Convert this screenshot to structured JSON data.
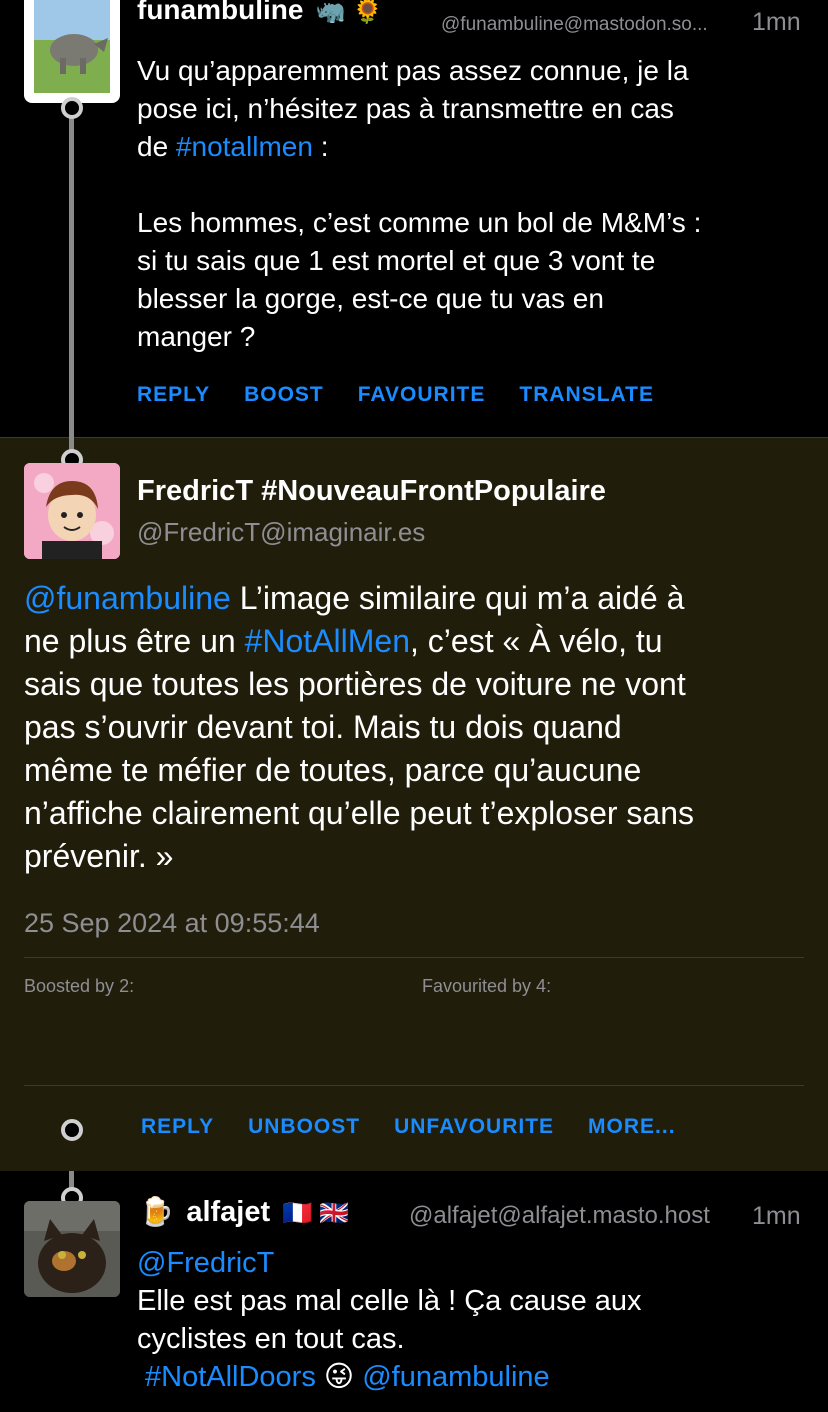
{
  "post1": {
    "display_name": "funambuline",
    "emojis": "🦏 🌻",
    "handle": "@funambuline@mastodon.so...",
    "time": "1mn",
    "text_line1": "Vu qu’apparemment pas assez connue, je la",
    "text_line2": "pose ici, n’hésitez pas à transmettre en cas",
    "text_line3_prefix": "de ",
    "hashtag": "#notallmen",
    "text_line3_suffix": " :",
    "para2_line1": "Les hommes, c’est comme un bol de M&M’s :",
    "para2_line2": "si tu sais que 1 est mortel et que 3 vont te",
    "para2_line3": "blesser la gorge, est-ce que tu vas en",
    "para2_line4": "manger ?",
    "actions": {
      "reply": "REPLY",
      "boost": "BOOST",
      "favourite": "FAVOURITE",
      "translate": "TRANSLATE"
    }
  },
  "post2": {
    "display_name": "FredricT #NouveauFrontPopulaire",
    "handle": "@FredricT@imaginair.es",
    "mention": "@funambuline",
    "line1_rest": " L’image similaire qui m’a aidé à",
    "line2_prefix": "ne plus être un ",
    "hashtag": "#NotAllMen",
    "line2_suffix": ", c’est « À vélo, tu",
    "line3": "sais que toutes les portières de voiture ne vont",
    "line4": "pas s’ouvrir devant toi. Mais tu dois quand",
    "line5": "même te méfier de toutes, parce qu’aucune",
    "line6": "n’affiche clairement qu’elle peut t’exploser sans",
    "line7": "prévenir. »",
    "timestamp": "25 Sep 2024 at 09:55:44",
    "boosted_by": "Boosted by 2:",
    "favourited_by": "Favourited by 4:",
    "actions": {
      "reply": "REPLY",
      "unboost": "UNBOOST",
      "unfavourite": "UNFAVOURITE",
      "more": "MORE..."
    }
  },
  "post3": {
    "prefix_emoji": "🍺",
    "display_name": "alfajet",
    "flags": "🇫🇷 🇬🇧",
    "handle": "@alfajet@alfajet.masto.host",
    "time": "1mn",
    "mention": "@FredricT",
    "line2": "Elle est pas mal celle là ! Ça cause aux",
    "line3": "cyclistes en tout cas.",
    "hashtag": "#NotAllDoors",
    "emoji": "😜",
    "mention2": "@funambuline"
  },
  "colors": {
    "accent": "#1a8cff",
    "highlight_bg": "#211d0b",
    "separator": "#3a3a3c"
  }
}
